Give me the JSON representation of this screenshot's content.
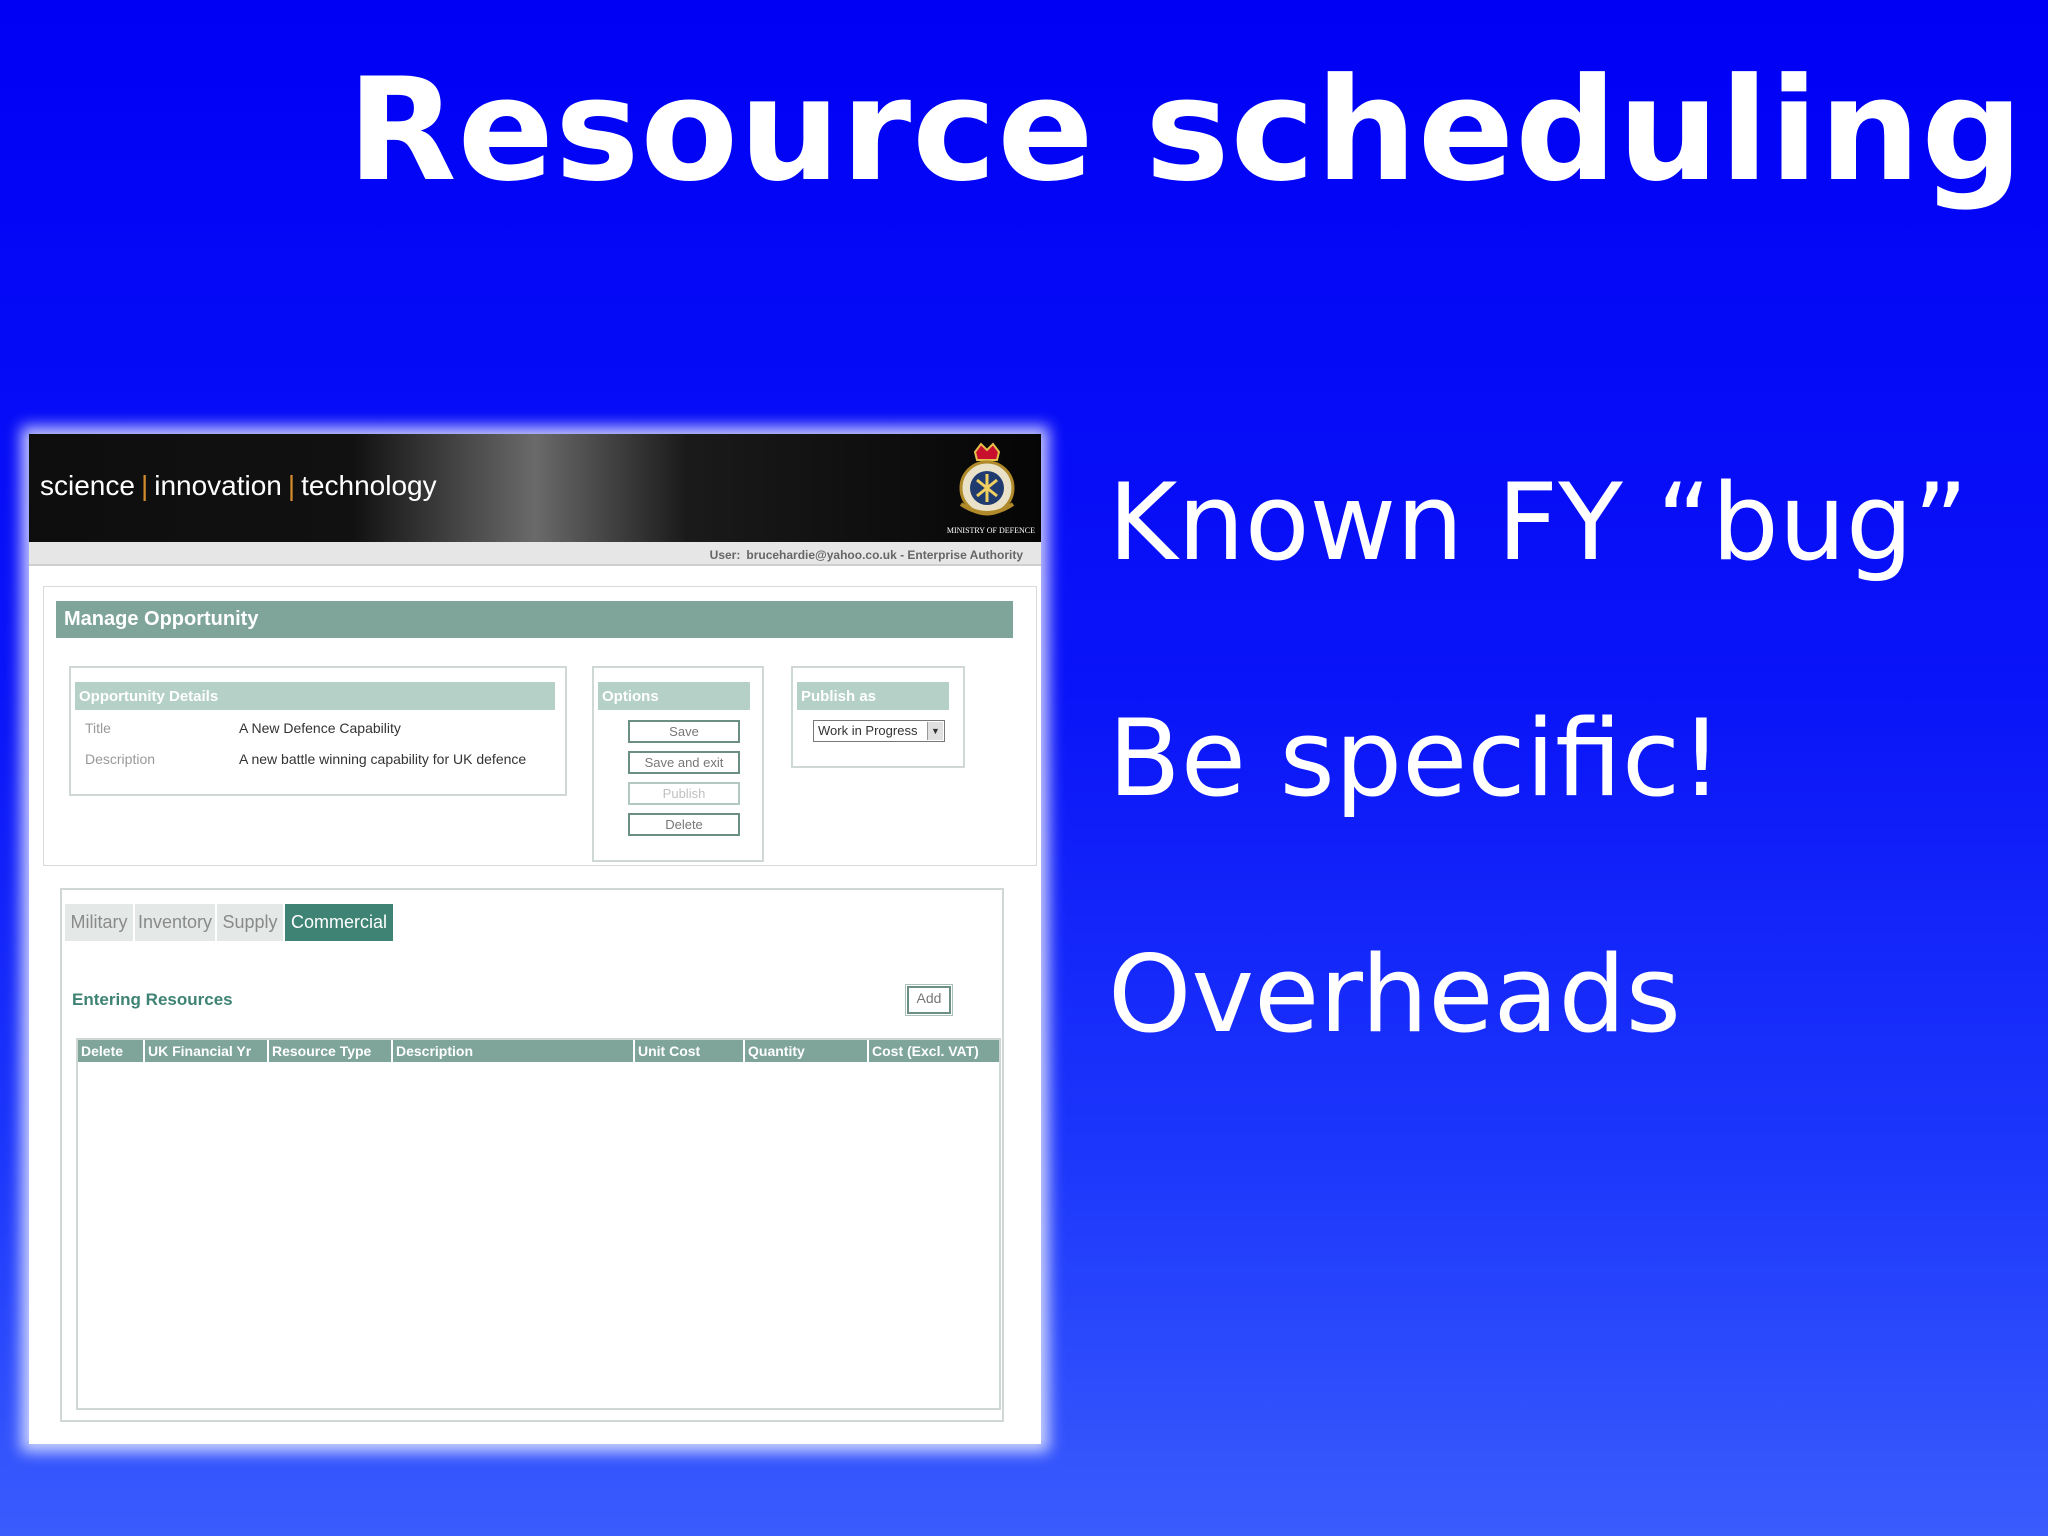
{
  "slide": {
    "title": "Resource scheduling",
    "bullets": [
      "Known FY “bug”",
      "Be specific!",
      "Overheads"
    ]
  },
  "app": {
    "brand": [
      "science",
      "innovation",
      "technology"
    ],
    "brand_separator": "|",
    "crest_label": "MINISTRY OF DEFENCE",
    "user_label": "User:",
    "user_value": "brucehardie@yahoo.co.uk - Enterprise Authority",
    "page_title": "Manage Opportunity",
    "details": {
      "heading": "Opportunity Details",
      "title_label": "Title",
      "title_value": "A New Defence Capability",
      "description_label": "Description",
      "description_value": "A new battle winning capability for UK defence"
    },
    "options": {
      "heading": "Options",
      "save": "Save",
      "save_exit": "Save and exit",
      "publish": "Publish",
      "delete": "Delete"
    },
    "publish_as": {
      "heading": "Publish as",
      "selected": "Work in Progress",
      "arrow_icon": "▼"
    },
    "tabs": [
      "Military",
      "Inventory",
      "Supply",
      "Commercial"
    ],
    "active_tab": "Commercial",
    "resources": {
      "heading": "Entering Resources",
      "add_label": "Add",
      "columns": [
        "Delete",
        "UK Financial Yr",
        "Resource Type",
        "Description",
        "Unit Cost",
        "Quantity",
        "Cost (Excl. VAT)"
      ],
      "rows": []
    }
  },
  "colors": {
    "slide_bg": "#0000f5",
    "header_teal": "#7fa59b",
    "active_tab": "#3e8374",
    "brand_separator": "#d18b2a"
  }
}
